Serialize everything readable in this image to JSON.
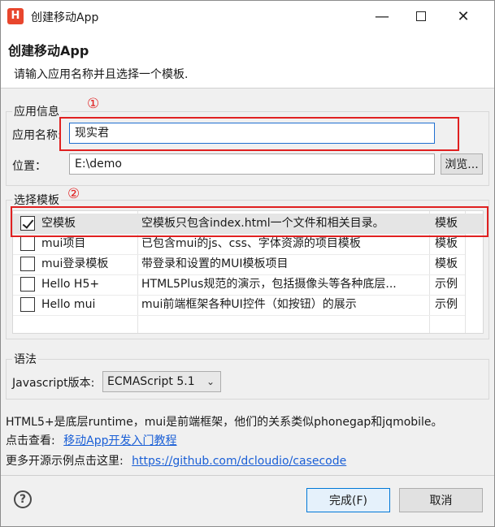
{
  "window": {
    "title": "创建移动App",
    "logo_text": "H",
    "minimize_glyph": "—",
    "close_glyph": "✕"
  },
  "header": {
    "title": "创建移动App",
    "description": "请输入应用名称并且选择一个模板."
  },
  "app_info": {
    "group_label": "应用信息",
    "name_label": "应用名称:",
    "name_value": "现实君",
    "location_label": "位置：",
    "location_value": "E:\\demo",
    "browse_label": "浏览..."
  },
  "annotations": {
    "one": "①",
    "two": "②",
    "color": "#e02020"
  },
  "template": {
    "group_label": "选择模板",
    "rows": [
      {
        "name": "空模板",
        "desc": "空模板只包含index.html一个文件和相关目录。",
        "type": "模板",
        "checked": true
      },
      {
        "name": "mui项目",
        "desc": "已包含mui的js、css、字体资源的项目模板",
        "type": "模板",
        "checked": false
      },
      {
        "name": "mui登录模板",
        "desc": "带登录和设置的MUI模板项目",
        "type": "模板",
        "checked": false
      },
      {
        "name": "Hello H5+",
        "desc": "HTML5Plus规范的演示，包括摄像头等各种底层...",
        "type": "示例",
        "checked": false
      },
      {
        "name": "Hello mui",
        "desc": "mui前端框架各种UI控件（如按钮）的展示",
        "type": "示例",
        "checked": false
      }
    ]
  },
  "syntax": {
    "group_label": "语法",
    "js_label": "Javascript版本:",
    "js_value": "ECMAScript 5.1"
  },
  "info": {
    "line1": "HTML5+是底层runtime，mui是前端框架，他们的关系类似phonegap和jqmobile。",
    "line2_prefix": "点击查看:",
    "line2_link": "移动App开发入门教程",
    "line3_prefix": "更多开源示例点击这里:",
    "line3_link": "https://github.com/dcloudio/casecode"
  },
  "footer": {
    "help_glyph": "?",
    "finish_label": "完成(F)",
    "cancel_label": "取消"
  },
  "colors": {
    "accent": "#1f6fd0",
    "link": "#1a5fd6",
    "logo": "#e8462d"
  }
}
